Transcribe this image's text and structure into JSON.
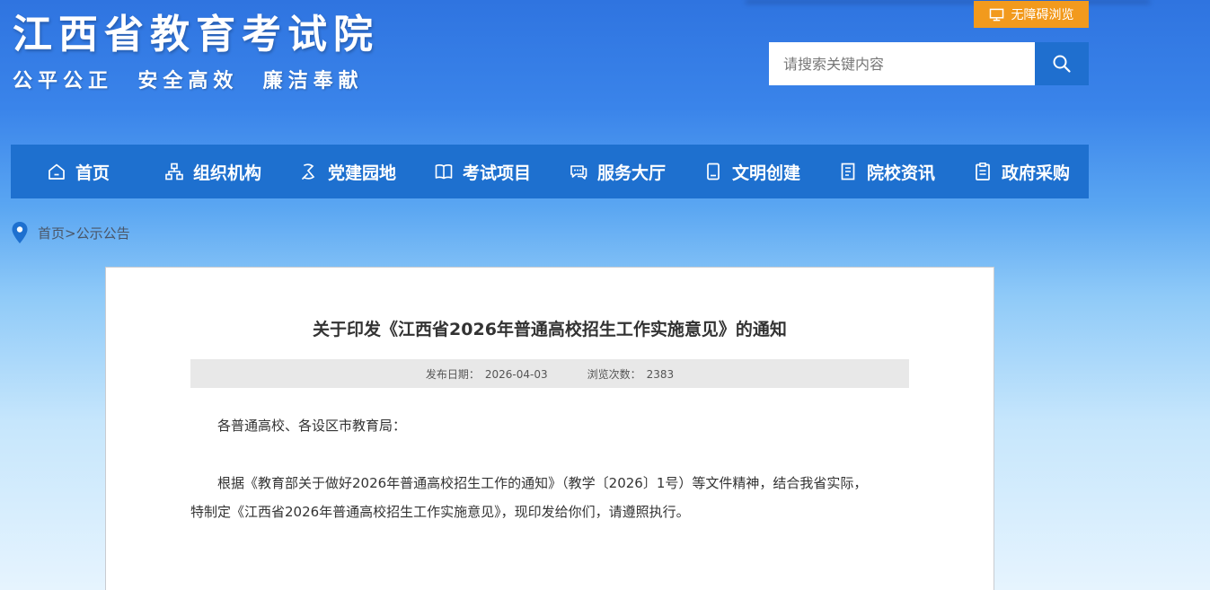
{
  "header": {
    "site_title": "江西省教育考试院",
    "slogan": "公平公正  安全高效  廉洁奉献",
    "accessibility_label": "无障碍浏览",
    "search_placeholder": "请搜索关键内容"
  },
  "nav": {
    "items": [
      {
        "label": "首页",
        "icon": "home-icon"
      },
      {
        "label": "组织机构",
        "icon": "org-chart-icon"
      },
      {
        "label": "党建园地",
        "icon": "party-icon"
      },
      {
        "label": "考试项目",
        "icon": "book-open-icon"
      },
      {
        "label": "服务大厅",
        "icon": "chat-icon"
      },
      {
        "label": "文明创建",
        "icon": "notebook-icon"
      },
      {
        "label": "院校资讯",
        "icon": "document-icon"
      },
      {
        "label": "政府采购",
        "icon": "clipboard-icon"
      }
    ]
  },
  "breadcrumb": {
    "home": "首页",
    "separator": ">",
    "current": "公示公告"
  },
  "article": {
    "title": "关于印发《江西省2026年普通高校招生工作实施意见》的通知",
    "publish_label": "发布日期：",
    "publish_date": "2026-04-03",
    "views_label": "浏览次数：",
    "views": "2383",
    "salutation": "各普通高校、各设区市教育局：",
    "body_line1": "根据《教育部关于做好2026年普通高校招生工作的通知》（教学〔2026〕1号）等文件精神，结合我省实际，",
    "body_line2": "特制定《江西省2026年普通高校招生工作实施意见》，现印发给你们，请遵照执行。"
  },
  "colors": {
    "nav_bg": "#1e70cf",
    "search_btn": "#1f6fcf",
    "access_btn": "#f29a1d"
  }
}
